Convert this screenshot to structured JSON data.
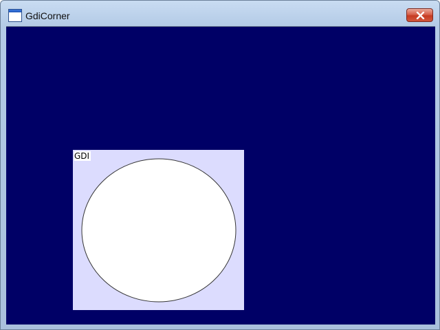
{
  "window": {
    "title": "GdiCorner"
  },
  "titlebar": {
    "app_icon": "window-icon",
    "close_icon": "close-x-icon"
  },
  "client": {
    "background_color": "#000066",
    "panel": {
      "label": "GDI",
      "background_color": "#dcdcfe",
      "circle_fill": "#ffffff",
      "circle_stroke": "#333333"
    }
  }
}
